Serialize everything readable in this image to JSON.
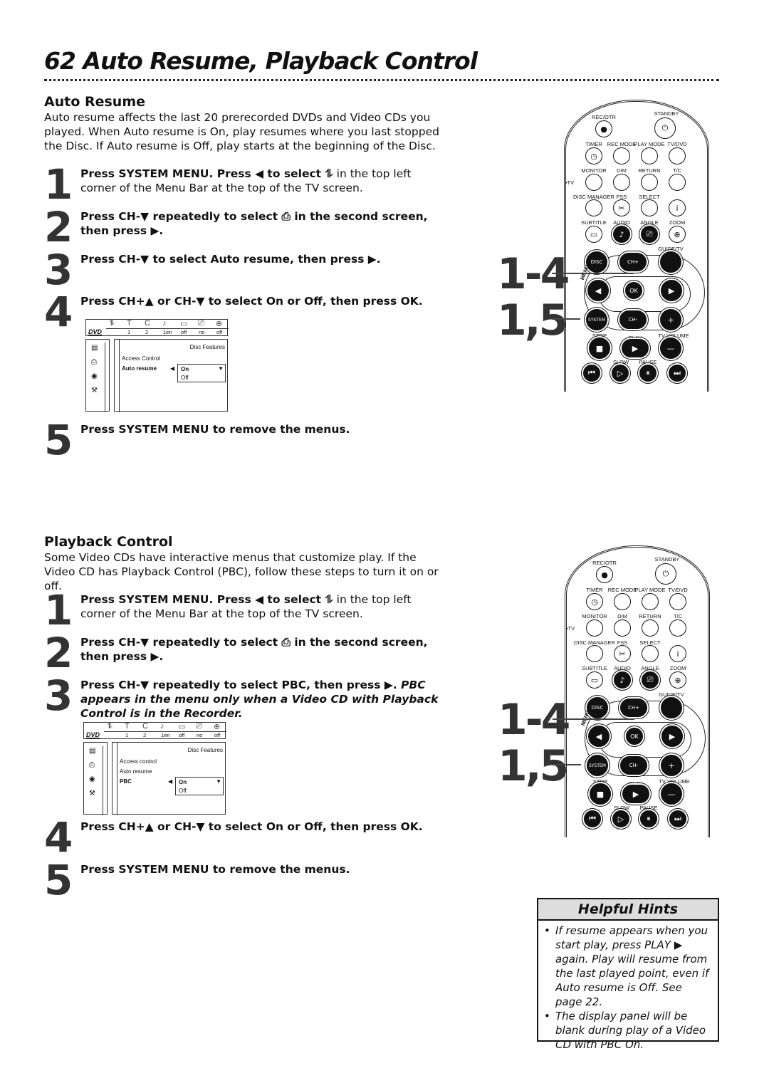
{
  "page_title": "62 Auto Resume, Playback Control",
  "auto_resume": {
    "heading": "Auto Resume",
    "intro": "Auto resume affects the last 20 prerecorded DVDs and Video CDs you played.  When Auto resume is On, play resumes where you last stopped the Disc. If Auto resume is Off, play starts at the beginning of the Disc.",
    "steps": [
      {
        "num": "1",
        "bold": "Press SYSTEM MENU. Press ◀ to select ⥮",
        "rest": " in the top left corner of the Menu Bar at the top of the TV screen."
      },
      {
        "num": "2",
        "bold": "Press CH-▼ repeatedly to select ⎙  in the second screen, then press ▶.",
        "rest": ""
      },
      {
        "num": "3",
        "bold": "Press CH-▼ to select Auto resume, then press ▶.",
        "rest": ""
      },
      {
        "num": "4",
        "bold": "Press CH+▲ or CH-▼ to select On or Off, then press OK.",
        "rest": ""
      },
      {
        "num": "5",
        "bold": "Press SYSTEM MENU to remove the menus.",
        "rest": ""
      }
    ]
  },
  "playback_control": {
    "heading": "Playback Control",
    "intro": "Some Video CDs have interactive menus that customize play. If the Video CD has Playback Control (PBC), follow these steps to turn it on or off.",
    "steps": [
      {
        "num": "1",
        "bold": "Press SYSTEM MENU. Press ◀ to select ⥮",
        "rest": " in the top left corner of the Menu Bar at the top of the TV screen."
      },
      {
        "num": "2",
        "bold": "Press CH-▼ repeatedly to select ⎙  in the second screen, then press ▶.",
        "rest": ""
      },
      {
        "num": "3",
        "bold": "Press CH-▼ repeatedly to select PBC, then press ▶.",
        "rest": " PBC appears in the menu only when a Video CD with Playback Control is in the Recorder."
      },
      {
        "num": "4",
        "bold": "Press CH+▲ or CH-▼ to select On or Off, then press OK.",
        "rest": ""
      },
      {
        "num": "5",
        "bold": "Press SYSTEM MENU to remove the menus.",
        "rest": ""
      }
    ]
  },
  "menu_bar": {
    "logo": "DVD",
    "icons": [
      "settings-icon",
      "title-icon",
      "chapter-icon",
      "audio-icon",
      "subtitle-icon",
      "angle-icon",
      "zoom-icon"
    ],
    "values": [
      "1",
      "2",
      "1en",
      "off",
      "no",
      "off"
    ],
    "section": "Disc Features"
  },
  "menu1": {
    "items": [
      "Access Control",
      "Auto resume"
    ],
    "options": [
      "On",
      "Off"
    ]
  },
  "menu2": {
    "items": [
      "Access control",
      "Auto resume",
      "PBC"
    ],
    "options": [
      "On",
      "Off"
    ]
  },
  "remote": {
    "callouts": [
      "1-4",
      "1,5"
    ],
    "menu_label": "MENU",
    "tv_label": "•TV",
    "labels": {
      "rec_otr": "REC/OTR",
      "standby": "STANDBY",
      "timer": "TIMER",
      "rec_mode": "REC MODE",
      "play_mode": "PLAY MODE",
      "tv_dvd": "TV/DVD",
      "monitor": "MONITOR",
      "dim": "DIM",
      "return": "RETURN",
      "tc": "T/C",
      "disc_manager": "DISC MANAGER",
      "fss": "FSS",
      "select": "SELECT",
      "subtitle": "SUBTITLE",
      "audio": "AUDIO",
      "angle": "ANGLE",
      "zoom": "ZOOM",
      "guide_tv": "GUIDE/TV",
      "disc": "DISC",
      "ch_plus": "CH+",
      "ok": "OK",
      "system": "SYSTEM",
      "ch_minus": "CH-",
      "stop": "STOP",
      "play": "PLAY",
      "tv_volume": "TV VOLUME",
      "slow": "SLOW",
      "pause": "PAUSE"
    }
  },
  "hints": {
    "title": "Helpful Hints",
    "items": [
      "If resume appears when you start play, press PLAY ▶ again. Play will resume from the last played point, even if Auto resume is Off. See page 22.",
      "The display panel will be blank during play of a Video CD with PBC On."
    ]
  }
}
